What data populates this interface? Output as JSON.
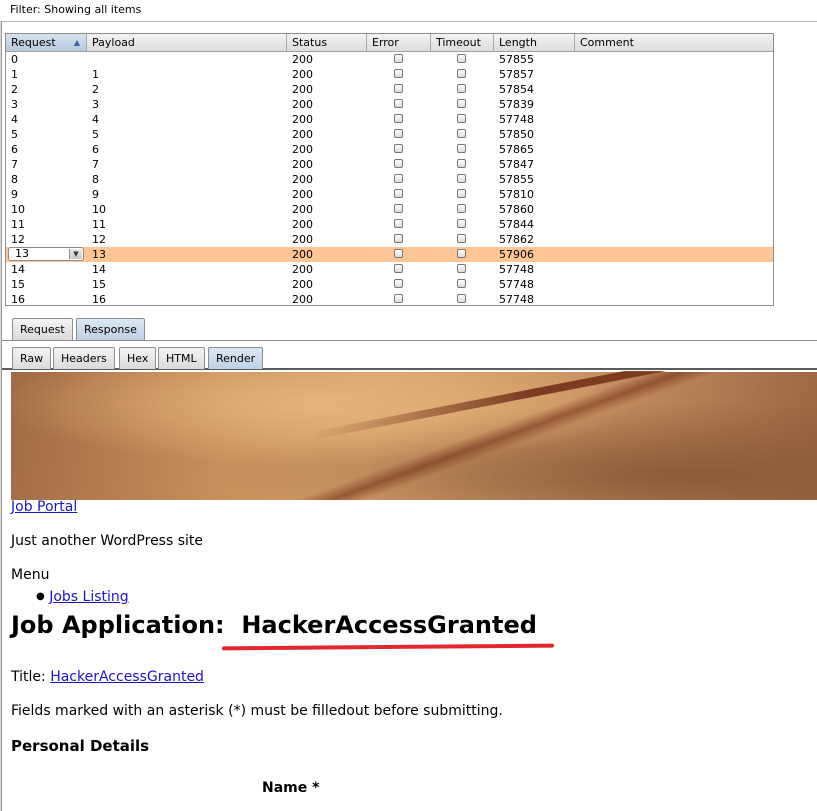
{
  "filter": {
    "text": "Filter: Showing all items"
  },
  "table": {
    "columns": [
      "Request",
      "Payload",
      "Status",
      "Error",
      "Timeout",
      "Length",
      "Comment"
    ],
    "selected_index": 13,
    "rows": [
      {
        "request": "0",
        "payload": "",
        "status": "200",
        "length": "57855"
      },
      {
        "request": "1",
        "payload": "1",
        "status": "200",
        "length": "57857"
      },
      {
        "request": "2",
        "payload": "2",
        "status": "200",
        "length": "57854"
      },
      {
        "request": "3",
        "payload": "3",
        "status": "200",
        "length": "57839"
      },
      {
        "request": "4",
        "payload": "4",
        "status": "200",
        "length": "57748"
      },
      {
        "request": "5",
        "payload": "5",
        "status": "200",
        "length": "57850"
      },
      {
        "request": "6",
        "payload": "6",
        "status": "200",
        "length": "57865"
      },
      {
        "request": "7",
        "payload": "7",
        "status": "200",
        "length": "57847"
      },
      {
        "request": "8",
        "payload": "8",
        "status": "200",
        "length": "57855"
      },
      {
        "request": "9",
        "payload": "9",
        "status": "200",
        "length": "57810"
      },
      {
        "request": "10",
        "payload": "10",
        "status": "200",
        "length": "57860"
      },
      {
        "request": "11",
        "payload": "11",
        "status": "200",
        "length": "57844"
      },
      {
        "request": "12",
        "payload": "12",
        "status": "200",
        "length": "57862"
      },
      {
        "request": "13",
        "payload": "13",
        "status": "200",
        "length": "57906"
      },
      {
        "request": "14",
        "payload": "14",
        "status": "200",
        "length": "57748"
      },
      {
        "request": "15",
        "payload": "15",
        "status": "200",
        "length": "57748"
      },
      {
        "request": "16",
        "payload": "16",
        "status": "200",
        "length": "57748"
      }
    ]
  },
  "tabs_top": [
    "Request",
    "Response"
  ],
  "tabs_top_active": "Response",
  "tabs_view": [
    "Raw",
    "Headers",
    "Hex",
    "HTML",
    "Render"
  ],
  "tabs_view_active": "Render",
  "render": {
    "site_link": "Job Portal",
    "tagline": "Just another WordPress site",
    "menu_label": "Menu",
    "menu_item": "Jobs Listing",
    "heading": "Job Application:  HackerAccessGranted",
    "title_label": "Title:",
    "title_value": "HackerAccessGranted",
    "fields_note": "Fields marked with an asterisk (*) must be filledout before submitting.",
    "section": "Personal Details",
    "name_label": "Name *"
  },
  "colors": {
    "selected_row": "#ffc594",
    "link": "#1a17c9",
    "annotation": "#e3262f"
  }
}
